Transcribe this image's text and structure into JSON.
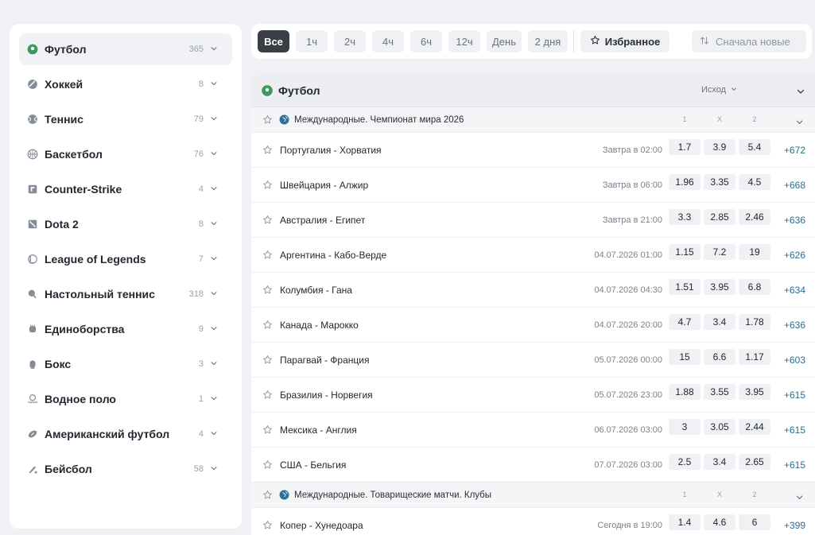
{
  "sidebar": {
    "items": [
      {
        "label": "Футбол",
        "count": "365",
        "icon": "soccer-ball-icon",
        "active": true
      },
      {
        "label": "Хоккей",
        "count": "8",
        "icon": "hockey-puck-icon"
      },
      {
        "label": "Теннис",
        "count": "79",
        "icon": "tennis-ball-icon"
      },
      {
        "label": "Баскетбол",
        "count": "76",
        "icon": "basketball-icon"
      },
      {
        "label": "Counter-Strike",
        "count": "4",
        "icon": "counter-strike-icon"
      },
      {
        "label": "Dota 2",
        "count": "8",
        "icon": "dota-icon"
      },
      {
        "label": "League of Legends",
        "count": "7",
        "icon": "league-of-legends-icon"
      },
      {
        "label": "Настольный теннис",
        "count": "318",
        "icon": "table-tennis-icon"
      },
      {
        "label": "Единоборства",
        "count": "9",
        "icon": "martial-arts-icon"
      },
      {
        "label": "Бокс",
        "count": "3",
        "icon": "boxing-glove-icon"
      },
      {
        "label": "Водное поло",
        "count": "1",
        "icon": "water-polo-icon"
      },
      {
        "label": "Американский футбол",
        "count": "4",
        "icon": "american-football-icon"
      },
      {
        "label": "Бейсбол",
        "count": "58",
        "icon": "baseball-icon"
      }
    ]
  },
  "filters": {
    "periods": [
      "Все",
      "1ч",
      "2ч",
      "4ч",
      "6ч",
      "12ч",
      "День",
      "2 дня"
    ],
    "active_period": "Все",
    "favorites_label": "Избранное",
    "sort_label": "Сначала новые"
  },
  "section": {
    "sport": "Футбол",
    "market": "Исход",
    "leagues": [
      {
        "name": "Международные. Чемпионат мира 2026",
        "col_labels": [
          "1",
          "X",
          "2"
        ],
        "matches": [
          {
            "teams": "Португалия - Хорватия",
            "time": "Завтра в 02:00",
            "odds": [
              "1.7",
              "3.9",
              "5.4"
            ],
            "more": "+672"
          },
          {
            "teams": "Швейцария - Алжир",
            "time": "Завтра в 06:00",
            "odds": [
              "1.96",
              "3.35",
              "4.5"
            ],
            "more": "+668"
          },
          {
            "teams": "Австралия - Египет",
            "time": "Завтра в 21:00",
            "odds": [
              "3.3",
              "2.85",
              "2.46"
            ],
            "more": "+636"
          },
          {
            "teams": "Аргентина - Кабо-Верде",
            "time": "04.07.2026 01:00",
            "odds": [
              "1.15",
              "7.2",
              "19"
            ],
            "more": "+626"
          },
          {
            "teams": "Колумбия - Гана",
            "time": "04.07.2026 04:30",
            "odds": [
              "1.51",
              "3.95",
              "6.8"
            ],
            "more": "+634"
          },
          {
            "teams": "Канада - Марокко",
            "time": "04.07.2026 20:00",
            "odds": [
              "4.7",
              "3.4",
              "1.78"
            ],
            "more": "+636"
          },
          {
            "teams": "Парагвай - Франция",
            "time": "05.07.2026 00:00",
            "odds": [
              "15",
              "6.6",
              "1.17"
            ],
            "more": "+603"
          },
          {
            "teams": "Бразилия - Норвегия",
            "time": "05.07.2026 23:00",
            "odds": [
              "1.88",
              "3.55",
              "3.95"
            ],
            "more": "+615"
          },
          {
            "teams": "Мексика - Англия",
            "time": "06.07.2026 03:00",
            "odds": [
              "3",
              "3.05",
              "2.44"
            ],
            "more": "+615"
          },
          {
            "teams": "США - Бельгия",
            "time": "07.07.2026 03:00",
            "odds": [
              "2.5",
              "3.4",
              "2.65"
            ],
            "more": "+615"
          }
        ]
      },
      {
        "name": "Международные. Товарищеские матчи. Клубы",
        "col_labels": [
          "1",
          "X",
          "2"
        ],
        "matches": [
          {
            "teams": "Копер - Хунедоара",
            "time": "Сегодня в 19:00",
            "odds": [
              "1.4",
              "4.6",
              "6"
            ],
            "more": "+399"
          }
        ]
      }
    ]
  }
}
